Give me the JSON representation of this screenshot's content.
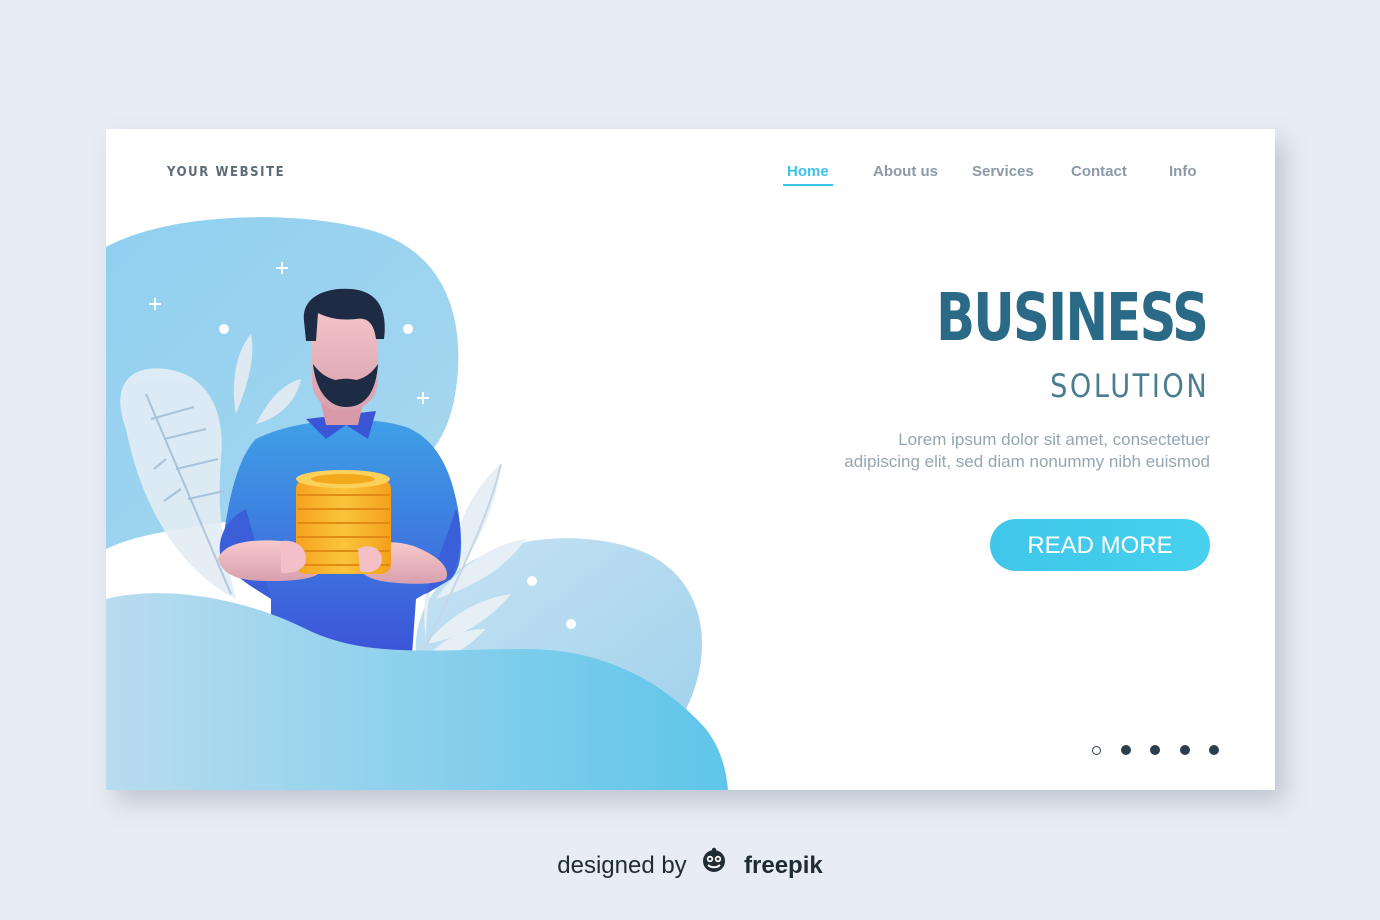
{
  "header": {
    "brand": "YOUR WEBSITE",
    "nav": [
      {
        "label": "Home",
        "active": true
      },
      {
        "label": "About us",
        "active": false
      },
      {
        "label": "Services",
        "active": false
      },
      {
        "label": "Contact",
        "active": false
      },
      {
        "label": "Info",
        "active": false
      }
    ]
  },
  "hero": {
    "title": "BUSINESS",
    "subtitle": "SOLUTION",
    "text": "Lorem ipsum dolor sit amet, consectetuer adipiscing elit, sed diam nonummy nibh euismod",
    "cta_label": "READ MORE"
  },
  "pagination": {
    "total": 5,
    "active_index": 0
  },
  "footer": {
    "prefix": "designed by",
    "brand": "freepik"
  },
  "colors": {
    "accent": "#3ec3e8",
    "title": "#2a6a86",
    "background": "#e8ecf4"
  }
}
